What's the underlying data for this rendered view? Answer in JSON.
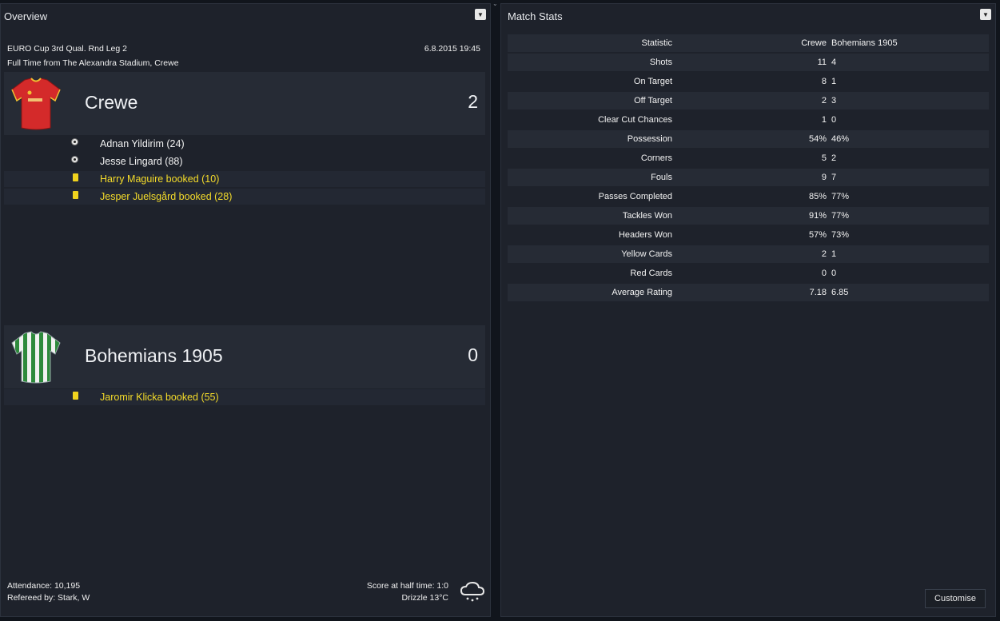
{
  "overview": {
    "title": "Overview",
    "competition": "EURO Cup 3rd Qual. Rnd Leg 2",
    "datetime": "6.8.2015 19:45",
    "venue": "Full Time from The Alexandra Stadium, Crewe",
    "home": {
      "name": "Crewe",
      "score": "2",
      "kit_color": "#d42a2a",
      "events": [
        {
          "type": "goal",
          "text": "Adnan Yildirim (24)"
        },
        {
          "type": "goal",
          "text": "Jesse Lingard (88)"
        },
        {
          "type": "booking",
          "text": "Harry Maguire booked (10)"
        },
        {
          "type": "booking",
          "text": "Jesper Juelsgård booked (28)"
        }
      ]
    },
    "away": {
      "name": "Bohemians 1905",
      "score": "0",
      "kit_color": "#2e8a3c",
      "events": [
        {
          "type": "booking",
          "text": "Jaromir Klicka booked (55)"
        }
      ]
    },
    "attendance": "Attendance: 10,195",
    "referee": "Refereed by: Stark, W",
    "halftime": "Score at half time: 1:0",
    "weather": "Drizzle 13°C",
    "weather_icon": "rain-cloud-icon"
  },
  "stats": {
    "title": "Match Stats",
    "headers": {
      "statistic": "Statistic",
      "home": "Crewe",
      "away": "Bohemians 1905"
    },
    "rows": [
      {
        "label": "Shots",
        "home": "11",
        "away": "4"
      },
      {
        "label": "On Target",
        "home": "8",
        "away": "1"
      },
      {
        "label": "Off Target",
        "home": "2",
        "away": "3"
      },
      {
        "label": "Clear Cut Chances",
        "home": "1",
        "away": "0"
      },
      {
        "label": "Possession",
        "home": "54%",
        "away": "46%"
      },
      {
        "label": "Corners",
        "home": "5",
        "away": "2"
      },
      {
        "label": "Fouls",
        "home": "9",
        "away": "7"
      },
      {
        "label": "Passes Completed",
        "home": "85%",
        "away": "77%"
      },
      {
        "label": "Tackles Won",
        "home": "91%",
        "away": "77%"
      },
      {
        "label": "Headers Won",
        "home": "57%",
        "away": "73%"
      },
      {
        "label": "Yellow Cards",
        "home": "2",
        "away": "1"
      },
      {
        "label": "Red Cards",
        "home": "0",
        "away": "0"
      },
      {
        "label": "Average Rating",
        "home": "7.18",
        "away": "6.85"
      }
    ],
    "customise_label": "Customise"
  },
  "colors": {
    "booking_text": "#f5dc2a",
    "panel_bg": "#1e222b"
  }
}
